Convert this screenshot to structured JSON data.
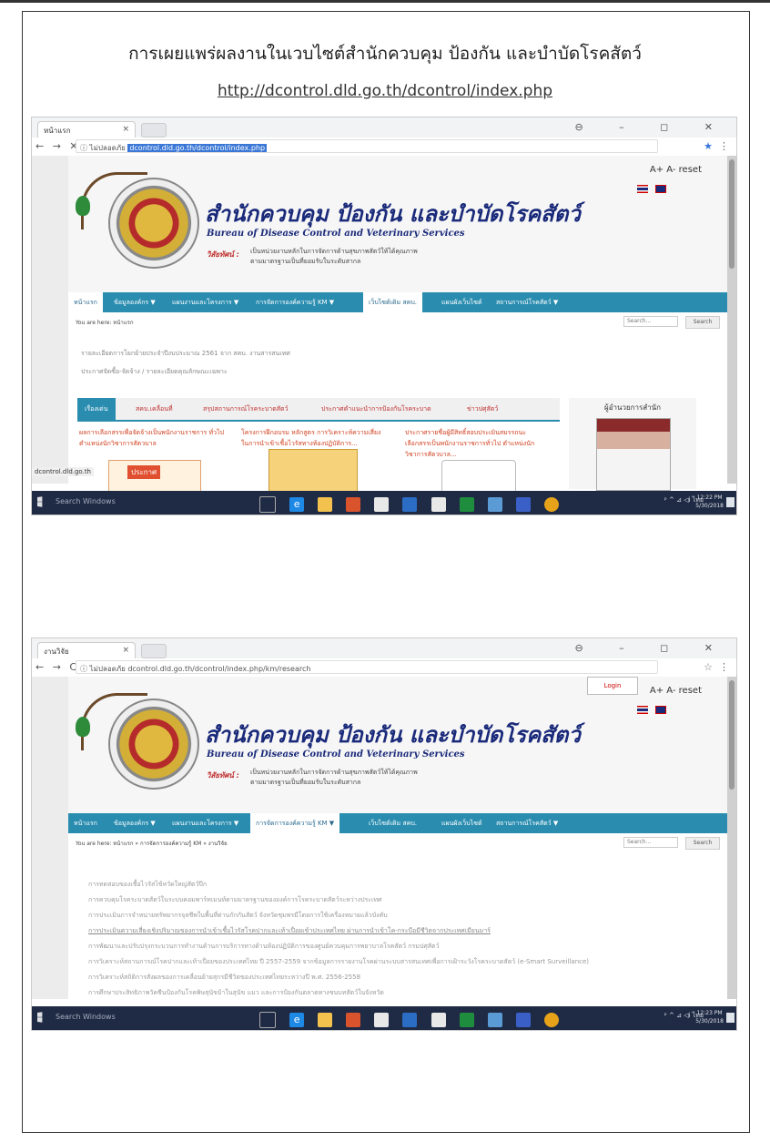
{
  "document": {
    "title": "การเผยแพร่ผลงานในเวบไซต์สำนักควบคุม ป้องกัน และบำบัดโรคสัตว์",
    "url": "http://dcontrol.dld.go.th/dcontrol/index.php"
  },
  "shot1": {
    "tab_title": "หน้าแรก",
    "close_glyph": "×",
    "nav_buttons": "← → ✕",
    "address_prefix": "ⓘ ไม่ปลอดภัย",
    "address_url": "dcontrol.dld.go.th/dcontrol/index.php",
    "window_controls": "⊖ – ◻ ✕",
    "site": {
      "title_th": "สำนักควบคุม ป้องกัน และบำบัดโรคสัตว์",
      "title_en": "Bureau of Disease Control and Veterinary Services",
      "vision_label": "วิสัยทัศน์ :",
      "vision_line1": "เป็นหน่วยงานหลักในการจัดการด้านสุขภาพสัตว์ให้ได้คุณภาพ",
      "vision_line2": "ตามมาตรฐานเป็นที่ยอมรับในระดับสากล",
      "font_controls": "A+  A-  reset"
    },
    "nav": [
      "หน้าแรก",
      "ข้อมูลองค์กร ▼",
      "แผนงานและโครงการ ▼",
      "การจัดการองค์ความรู้ KM ▼",
      "เว็บไซต์เดิม สคบ.",
      "แผนผังเว็บไซต์",
      "สถานการณ์โรคสัตว์ ▼"
    ],
    "breadcrumb": "You are here: หน้าแรก",
    "search_placeholder": "Search...",
    "search_button": "Search",
    "news": [
      "รายละเอียดการโยกย้ายประจำปีงบประมาณ 2561 จาก สคบ. งานสารสนเทศ",
      "ประกาศจัดซื้อ-จัดจ้าง / รายละเอียดคุณลักษณะเฉพาะ"
    ],
    "content_tabs": [
      "เรื่องเด่น",
      "สคบ.เคลื่อนที่",
      "สรุปสถานการณ์โรคระบาดสัตว์",
      "ประกาศคำแนะนำการป้องกันโรคระบาด",
      "ข่าวปศุสัตว์"
    ],
    "col1_text": "ผลการเลือกสรรเพื่อจัดจ้างเป็นพนักงานราชการ ทั่วไป ตำแหน่งนักวิชาการสัตวบาล",
    "col2_text": "โครงการฝึกอบรม หลักสูตร การวิเคราะห์ความเสี่ยงในการนำเข้าเชื้อไวรัสทางห้องปฏิบัติการ...",
    "col3_text": "ประกาศรายชื่อผู้มีสิทธิ์สอบประเมินสมรรถนะ เลือกสรรเป็นพนักงานราชการทั่วไป ตำแหน่งนักวิชาการสัตวบาล...",
    "poster_label": "ประกาศ",
    "director_title": "ผู้อำนวยการสำนัก",
    "status_url": "dcontrol.dld.go.th",
    "taskbar": {
      "search": "Search Windows",
      "time": "12:22 PM",
      "date": "5/30/2018",
      "tray": "ᵖ ^ ⊿ ◁ⅰ ไทย"
    }
  },
  "shot2": {
    "tab_title": "งานวิจัย",
    "close_glyph": "×",
    "nav_buttons": "← → C",
    "address_prefix": "ⓘ ไม่ปลอดภัย",
    "address_url": "dcontrol.dld.go.th/dcontrol/index.php/km/research",
    "window_controls": "⊖ – ◻ ✕",
    "login": "Login",
    "site": {
      "title_th": "สำนักควบคุม ป้องกัน และบำบัดโรคสัตว์",
      "title_en": "Bureau of Disease Control and Veterinary Services",
      "vision_label": "วิสัยทัศน์ :",
      "vision_line1": "เป็นหน่วยงานหลักในการจัดการด้านสุขภาพสัตว์ให้ได้คุณภาพ",
      "vision_line2": "ตามมาตรฐานเป็นที่ยอมรับในระดับสากล",
      "font_controls": "A+  A-  reset"
    },
    "nav": [
      "หน้าแรก",
      "ข้อมูลองค์กร ▼",
      "แผนงานและโครงการ ▼",
      "การจัดการองค์ความรู้ KM ▼",
      "เว็บไซต์เดิม สคบ.",
      "แผนผังเว็บไซต์",
      "สถานการณ์โรคสัตว์ ▼"
    ],
    "breadcrumb": "You are here: หน้าแรก » การจัดการองค์ความรู้ KM » งานวิจัย",
    "search_placeholder": "Search...",
    "search_button": "Search",
    "research": [
      "การทดสอบของเชื้อไวรัสไข้หวัดใหญ่สัตว์ปีก",
      "การควบคุมโรคระบาดสัตว์ในระบบคอมพาร์ทเมนท์ตามมาตรฐานขององค์การโรคระบาดสัตว์ระหว่างประเทศ",
      "การประเมินการจำหน่ายทรัพยากรจุลชีพในพื้นที่ด่านกักกันสัตว์ จังหวัดชุมพรมีโดยการใช้เครื่องหมายแล้วบังคับ",
      "การประเมินความเสี่ยงเชิงปริมาณของการนำเข้าเชื้อไวรัสโรคปากและเท้าเปื่อยเข้าประเทศไทย ผ่านการนำเข้าโค-กระบือมีชีวิตจากประเทศเมียนมาร์",
      "การพัฒนาและปรับปรุงกระบวนการทำงานด้านการบริการทางด้านห้องปฏิบัติการของศูนย์ควบคุมการพยาบาลโรคสัตว์ กรมปศุสัตว์",
      "การวิเคราะห์สถานการณ์โรคปากและเท้าเปื่อยของประเทศไทย ปี 2557-2559 จากข้อมูลการรายงานโรคผ่านระบบสารสนเทศเพื่อการเฝ้าระวังโรคระบาดสัตว์ (e-Smart Surveillance)",
      "การวิเคราะห์สถิติการสังผลของการเคลื่อนย้ายสุกรมีชีวิตของประเทศไทยระหว่างปี พ.ศ. 2556-2558",
      "การศึกษาประสิทธิภาพวัคซีนป้องกันโรคพิษสุนัขบ้าในสุนัข แมว และการป้องกันตลาดทางชนบทสัตว์ในจังหวัด"
    ],
    "taskbar": {
      "search": "Search Windows",
      "time": "12:23 PM",
      "date": "5/30/2018",
      "tray": "ᵖ ^ ⊿ ◁ⅰ ไทย"
    }
  }
}
